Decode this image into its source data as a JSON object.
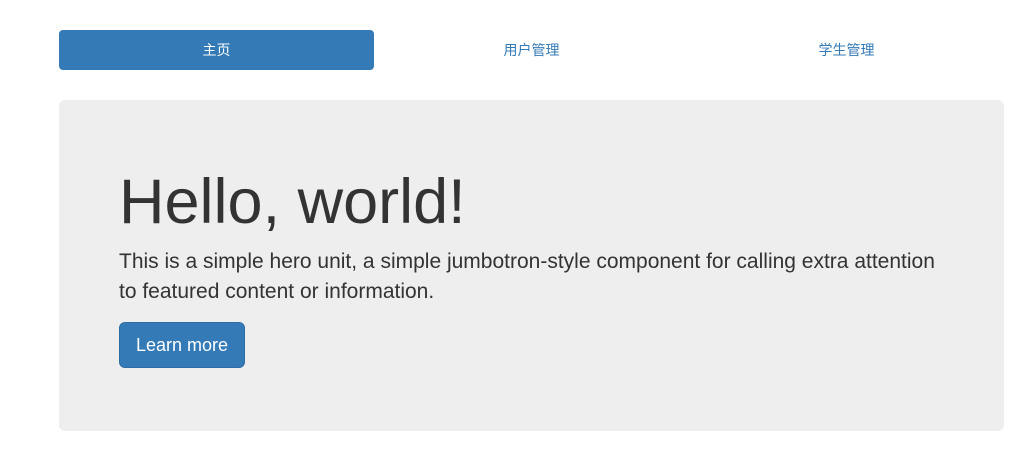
{
  "nav": {
    "items": [
      {
        "label": "主页",
        "active": true
      },
      {
        "label": "用户管理",
        "active": false
      },
      {
        "label": "学生管理",
        "active": false
      }
    ]
  },
  "hero": {
    "heading": "Hello, world!",
    "text": "This is a simple hero unit, a simple jumbotron-style component for calling extra attention to featured content or information.",
    "button_label": "Learn more"
  },
  "colors": {
    "primary": "#337ab7",
    "jumbotron_bg": "#eeeeee",
    "text": "#333333"
  }
}
